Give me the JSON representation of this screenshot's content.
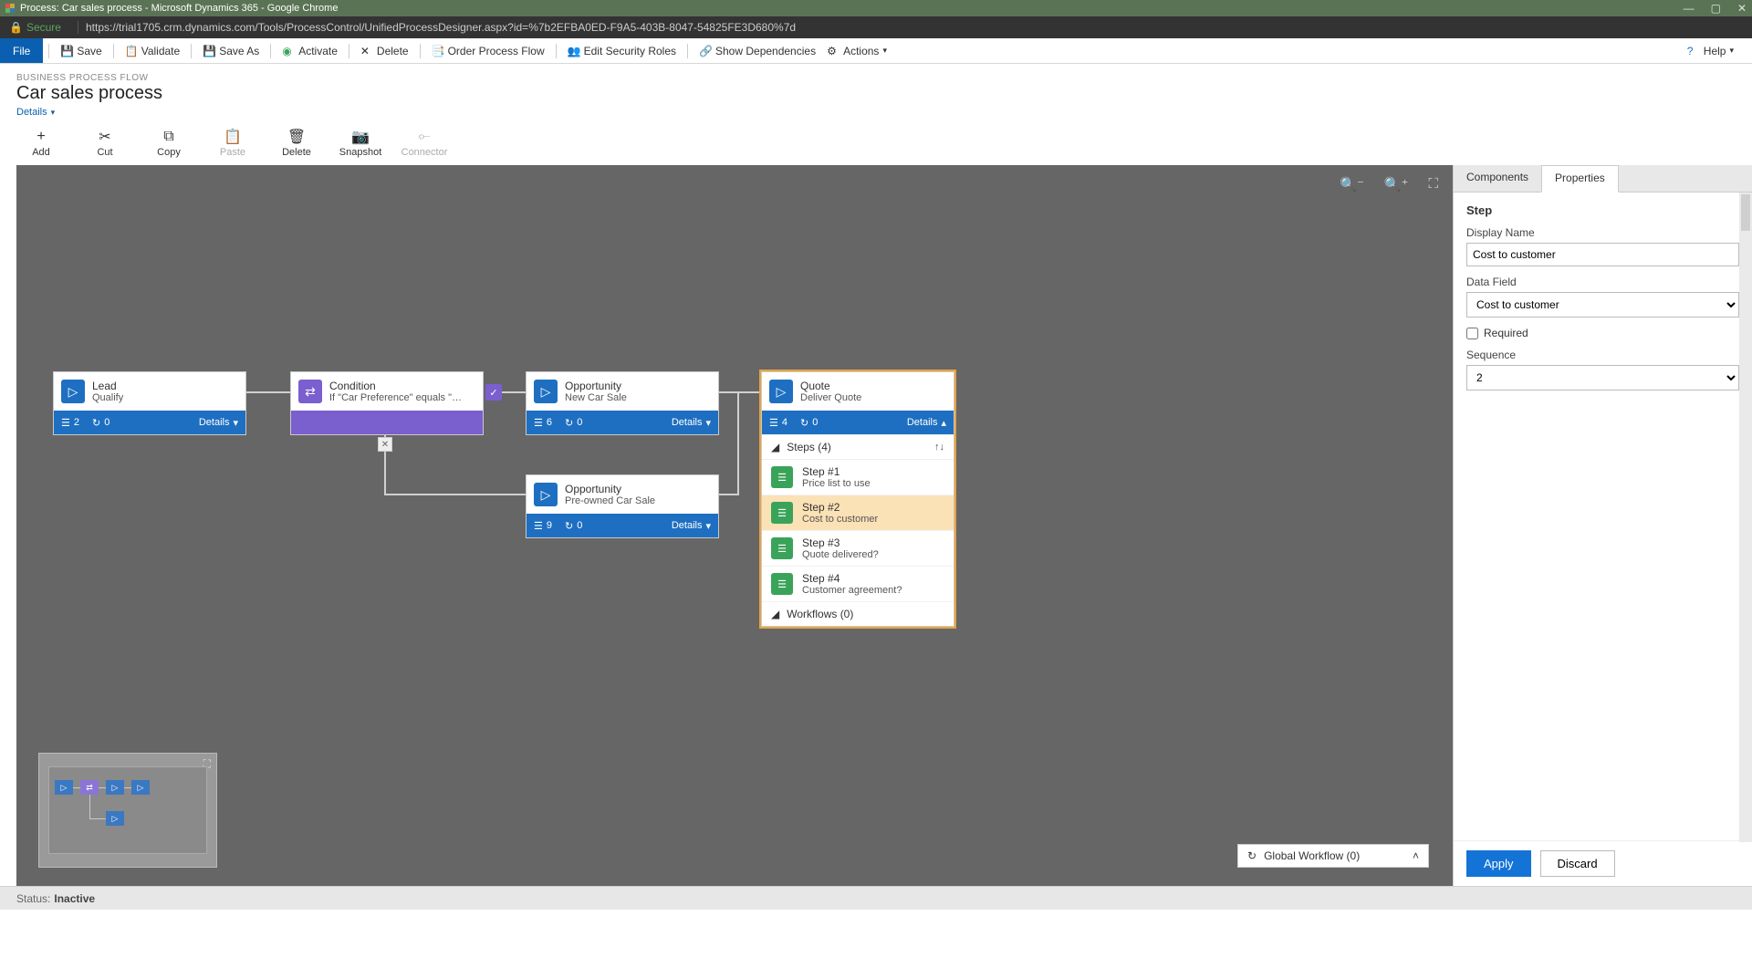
{
  "window": {
    "title": "Process: Car sales process - Microsoft Dynamics 365 - Google Chrome",
    "url_secure": "Secure",
    "url": "https://trial1705.crm.dynamics.com/Tools/ProcessControl/UnifiedProcessDesigner.aspx?id=%7b2EFBA0ED-F9A5-403B-8047-54825FE3D680%7d"
  },
  "ribbon": {
    "file": "File",
    "save": "Save",
    "save_as": "Save As",
    "validate": "Validate",
    "activate": "Activate",
    "delete": "Delete",
    "order": "Order Process Flow",
    "edit_security": "Edit Security Roles",
    "show_deps": "Show Dependencies",
    "actions": "Actions",
    "help": "Help"
  },
  "header": {
    "crumb": "BUSINESS PROCESS FLOW",
    "title": "Car sales process",
    "details": "Details"
  },
  "toolbar": {
    "add": "Add",
    "cut": "Cut",
    "copy": "Copy",
    "paste": "Paste",
    "delete": "Delete",
    "snapshot": "Snapshot",
    "connector": "Connector"
  },
  "stages": {
    "lead": {
      "name": "Lead",
      "sub": "Qualify",
      "steps": "2",
      "wf": "0",
      "details": "Details"
    },
    "condition": {
      "name": "Condition",
      "sub": "If \"Car Preference\" equals \"New ..."
    },
    "opp_new": {
      "name": "Opportunity",
      "sub": "New Car Sale",
      "steps": "6",
      "wf": "0",
      "details": "Details"
    },
    "opp_pre": {
      "name": "Opportunity",
      "sub": "Pre-owned Car Sale",
      "steps": "9",
      "wf": "0",
      "details": "Details"
    },
    "quote": {
      "name": "Quote",
      "sub": "Deliver Quote",
      "steps": "4",
      "wf": "0",
      "details": "Details",
      "steps_header": "Steps (4)",
      "step_list": [
        {
          "num": "Step #1",
          "label": "Price list to use"
        },
        {
          "num": "Step #2",
          "label": "Cost to customer"
        },
        {
          "num": "Step #3",
          "label": "Quote delivered?"
        },
        {
          "num": "Step #4",
          "label": "Customer agreement?"
        }
      ],
      "workflows": "Workflows (0)"
    }
  },
  "global_wf": "Global Workflow (0)",
  "right": {
    "tab_components": "Components",
    "tab_properties": "Properties",
    "section": "Step",
    "display_name_label": "Display Name",
    "display_name_value": "Cost to customer",
    "data_field_label": "Data Field",
    "data_field_value": "Cost to customer",
    "required": "Required",
    "sequence_label": "Sequence",
    "sequence_value": "2",
    "apply": "Apply",
    "discard": "Discard"
  },
  "status": {
    "label": "Status:",
    "value": "Inactive"
  }
}
